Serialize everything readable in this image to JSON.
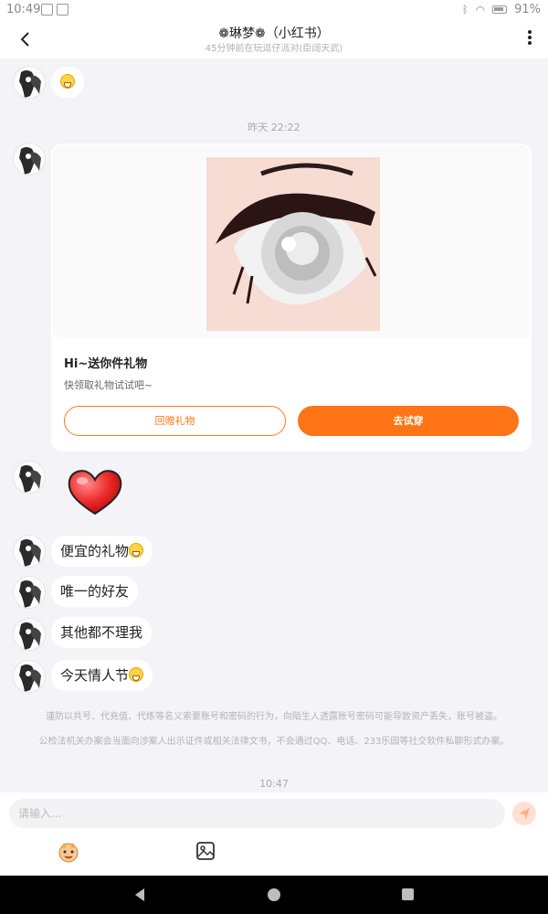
{
  "status_bar": {
    "time": "10:49",
    "battery": "91%"
  },
  "header": {
    "title": "❁琳梦❁（小红书）",
    "subtitle": "45分钟前在玩逗仔派对(臣阔天武)"
  },
  "messages": {
    "m1_emoji": "",
    "timestamp1": "昨天 22:22",
    "gift_card": {
      "title": "Hi~送你件礼物",
      "desc": "快领取礼物试试吧~",
      "return_label": "回赠礼物",
      "try_label": "去试穿"
    },
    "m2": "便宜的礼物",
    "m3": "唯一的好友",
    "m4": "其他都不理我",
    "m5": "今天情人节"
  },
  "notice": {
    "line1": "谨防以共号、代充值、代练等名义索要账号和密码的行为，向陌生人透露账号密码可能导致资产丢失，账号被盗。",
    "line2": "公检法机关办案会当面向涉案人出示证件或相关法律文书，不会通过QQ、电话、233乐园等社交软件私聊形式办案。"
  },
  "timestamp2": "10:47",
  "input": {
    "placeholder": "请输入..."
  },
  "colors": {
    "accent": "#ff7416",
    "background": "#f3f3f8"
  },
  "icons": {
    "back": "chevron-left-icon",
    "more": "more-vertical-icon",
    "send": "send-icon",
    "emoji_tool": "emoji-face-icon",
    "image_tool": "image-icon"
  }
}
